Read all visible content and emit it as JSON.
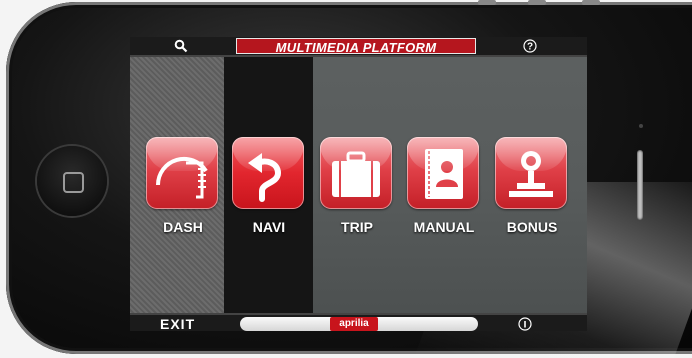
{
  "header": {
    "title": "MULTIMEDIA PLATFORM",
    "search_icon": "search-icon",
    "help_icon": "help-icon"
  },
  "menu": {
    "items": [
      {
        "label": "DASH",
        "icon": "speedometer-icon",
        "active": false
      },
      {
        "label": "NAVI",
        "icon": "turn-arrow-icon",
        "active": true
      },
      {
        "label": "TRIP",
        "icon": "suitcase-icon",
        "active": false
      },
      {
        "label": "MANUAL",
        "icon": "book-icon",
        "active": false
      },
      {
        "label": "BONUS",
        "icon": "trophy-icon",
        "active": false
      }
    ]
  },
  "footer": {
    "exit_label": "EXIT",
    "brand_label": "aprilia",
    "info_icon": "info-icon"
  },
  "colors": {
    "accent_red": "#c8141c",
    "bar_black": "#1b1b1b"
  }
}
